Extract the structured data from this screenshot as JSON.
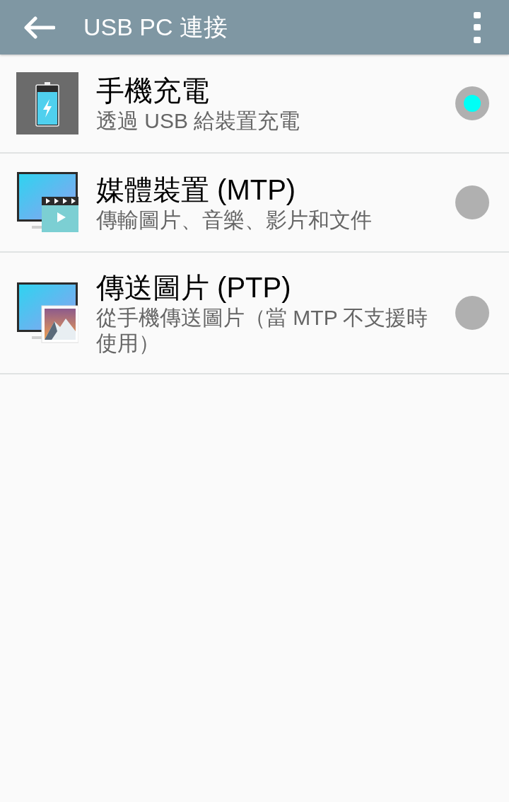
{
  "app_bar": {
    "title": "USB PC 連接"
  },
  "options": [
    {
      "kind": "charge",
      "title": "手機充電",
      "subtitle": "透過 USB 給裝置充電",
      "selected": true
    },
    {
      "kind": "media",
      "title": "媒體裝置 (MTP)",
      "subtitle": "傳輸圖片、音樂、影片和文件",
      "selected": false
    },
    {
      "kind": "photo",
      "title": "傳送圖片 (PTP)",
      "subtitle": "從手機傳送圖片（當 MTP 不支援時使用）",
      "selected": false
    }
  ]
}
